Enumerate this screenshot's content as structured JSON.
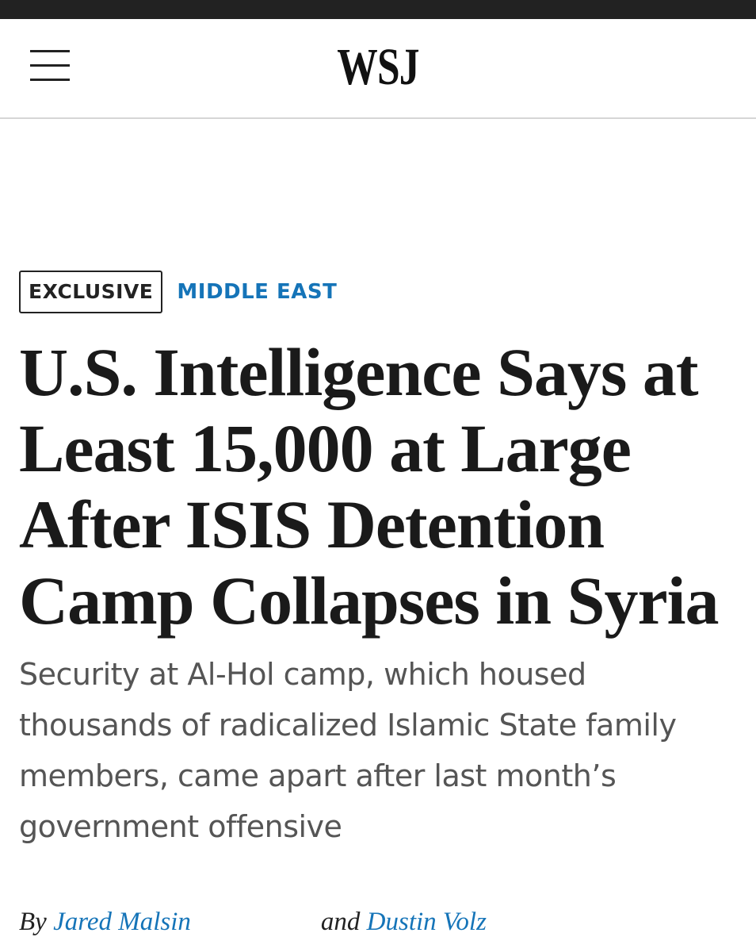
{
  "header": {
    "logo": "WSJ",
    "menu_icon": "hamburger-menu-icon"
  },
  "article": {
    "flag": "EXCLUSIVE",
    "section": "MIDDLE EAST",
    "headline": "U.S. Intelligence Says at Least 15,000 at Large After ISIS Detention Camp Collapses in Syria",
    "dek": "Security at Al-Hol camp, which housed thousands of radicalized Islamic State family members, came apart after last month’s government offensive",
    "byline": {
      "prefix": "By",
      "author_1": "Jared Malsin",
      "joiner": "and",
      "author_2": "Dustin Volz"
    }
  },
  "colors": {
    "accent_link": "#1574b8",
    "headline": "#1a1a1a",
    "dek": "#555555"
  }
}
